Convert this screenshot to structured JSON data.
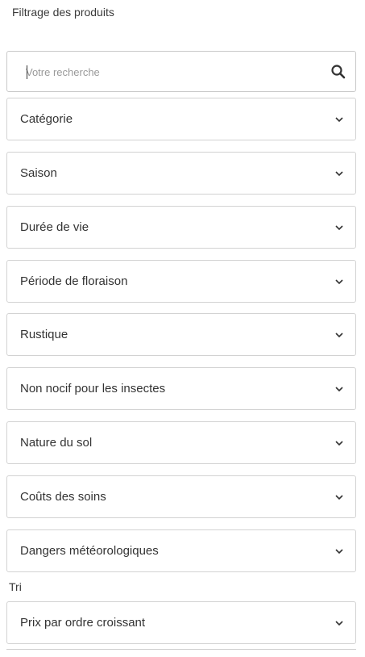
{
  "panel": {
    "title": "Filtrage des produits"
  },
  "search": {
    "placeholder": "Votre recherche",
    "value": ""
  },
  "filters": [
    {
      "label": "Catégorie"
    },
    {
      "label": "Saison"
    },
    {
      "label": "Durée de vie"
    },
    {
      "label": "Période de floraison"
    },
    {
      "label": "Rustique"
    },
    {
      "label": "Non nocif pour les insectes"
    },
    {
      "label": "Nature du sol"
    },
    {
      "label": "Coûts des soins"
    },
    {
      "label": "Dangers météorologiques"
    }
  ],
  "sort": {
    "heading": "Tri",
    "selected": "Prix par ordre croissant"
  },
  "icons": {
    "search": "search-icon",
    "dropdown": "chevron-down-icon"
  },
  "colors": {
    "border": "#d2d2d2",
    "text": "#333333",
    "placeholder": "#9a9a9a"
  }
}
